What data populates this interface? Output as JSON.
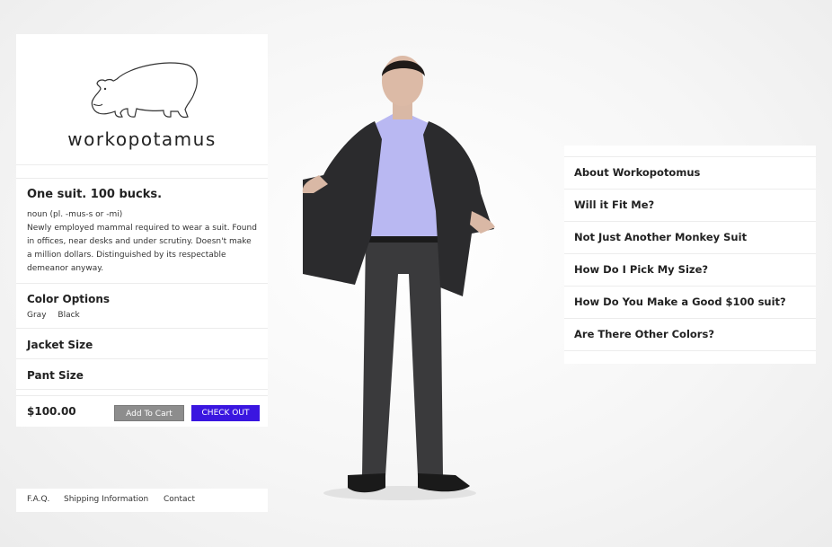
{
  "brand": {
    "name": "workopotamus"
  },
  "product": {
    "tagline": "One suit. 100 bucks.",
    "definition_pos": "noun (pl. -mus-s or -mi)",
    "definition_body": "Newly employed mammal required to wear a suit. Found in offices, near desks and under scrutiny. Doesn't make a million dollars. Distinguished by its respectable demeanor anyway.",
    "color_options_title": "Color Options",
    "colors": [
      "Gray",
      "Black"
    ],
    "jacket_size_label": "Jacket Size",
    "pant_size_label": "Pant Size",
    "price": "$100.00",
    "add_to_cart_label": "Add To Cart",
    "checkout_label": "CHECK OUT"
  },
  "footer": {
    "links": [
      "F.A.Q.",
      "Shipping Information",
      "Contact"
    ]
  },
  "faq": {
    "items": [
      "About Workopotomus",
      "Will it Fit Me?",
      "Not Just Another Monkey Suit",
      "How Do I Pick My Size?",
      "How Do You Make a Good $100 suit?",
      "Are There Other Colors?"
    ]
  },
  "colors": {
    "checkout_button": "#3a16e0",
    "add_to_cart_button": "#8d8d8d",
    "panel_background": "#ffffff"
  }
}
